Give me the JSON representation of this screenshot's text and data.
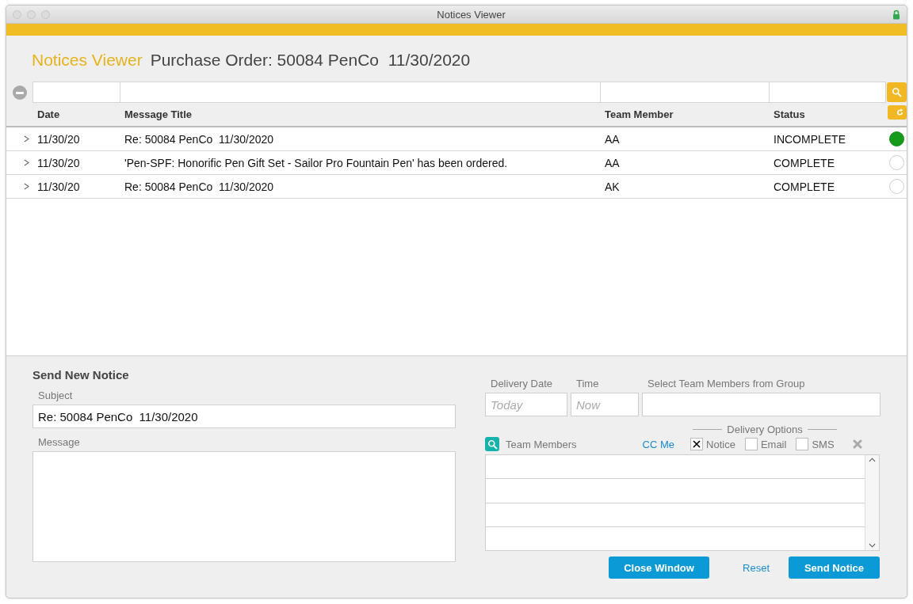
{
  "window": {
    "title": "Notices Viewer"
  },
  "header": {
    "app_name": "Notices Viewer",
    "subtitle": "Purchase Order: 50084 PenCo  11/30/2020"
  },
  "table": {
    "columns": [
      "Date",
      "Message Title",
      "Team Member",
      "Status"
    ],
    "rows": [
      {
        "date": "11/30/20",
        "title": "Re: 50084 PenCo  11/30/2020",
        "member": "AA",
        "status": "INCOMPLETE",
        "open": true
      },
      {
        "date": "11/30/20",
        "title": "'Pen-SPF: Honorific Pen Gift Set - Sailor Pro Fountain Pen' has been ordered.",
        "member": "AA",
        "status": "COMPLETE",
        "open": false
      },
      {
        "date": "11/30/20",
        "title": "Re: 50084 PenCo  11/30/2020",
        "member": "AK",
        "status": "COMPLETE",
        "open": false
      }
    ]
  },
  "form": {
    "heading": "Send New Notice",
    "subject": {
      "label": "Subject",
      "value": "Re: 50084 PenCo  11/30/2020"
    },
    "message": {
      "label": "Message"
    },
    "delivery_date": {
      "label": "Delivery Date",
      "placeholder": "Today"
    },
    "time": {
      "label": "Time",
      "placeholder": "Now"
    },
    "group": {
      "label": "Select Team Members from Group"
    },
    "team_members": {
      "label": "Team Members"
    },
    "cc_me": "CC Me",
    "delivery_options": {
      "label": "Delivery Options",
      "options": [
        {
          "label": "Notice",
          "checked": true
        },
        {
          "label": "Email",
          "checked": false
        },
        {
          "label": "SMS",
          "checked": false
        }
      ]
    },
    "buttons": {
      "close": "Close Window",
      "reset": "Reset",
      "send": "Send Notice"
    }
  }
}
